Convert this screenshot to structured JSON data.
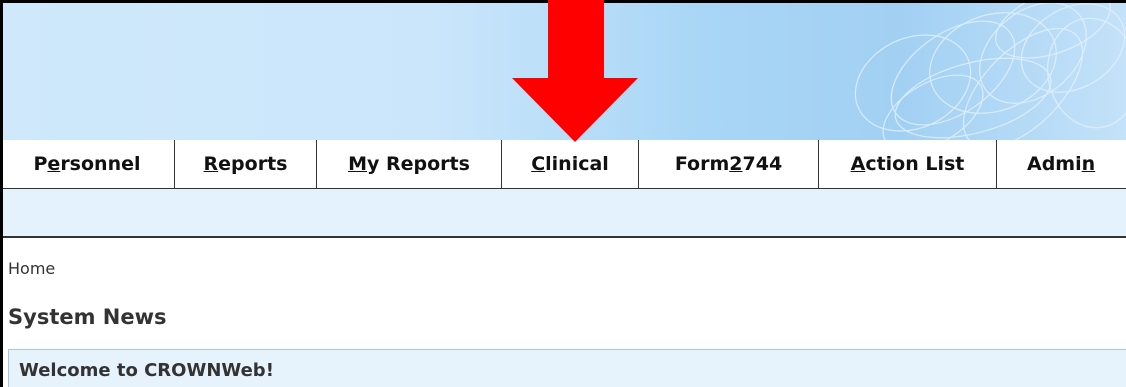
{
  "nav": {
    "items": [
      {
        "pre": "P",
        "key": "e",
        "post": "rsonnel"
      },
      {
        "pre": "",
        "key": "R",
        "post": "eports"
      },
      {
        "pre": "",
        "key": "M",
        "post": "y Reports"
      },
      {
        "pre": "",
        "key": "C",
        "post": "linical"
      },
      {
        "pre": "Form ",
        "key": "2",
        "post": "744"
      },
      {
        "pre": "",
        "key": "A",
        "post": "ction List"
      },
      {
        "pre": "Admi",
        "key": "n",
        "post": ""
      }
    ]
  },
  "breadcrumb": "Home",
  "section_title": "System News",
  "news_item_title": "Welcome to CROWNWeb!",
  "colors": {
    "arrow": "#ff0000",
    "banner_light": "#cfe8fb",
    "banner_mid": "#a2d0f3",
    "subbar": "#e3f2fd",
    "news_box": "#e6f3fc"
  }
}
